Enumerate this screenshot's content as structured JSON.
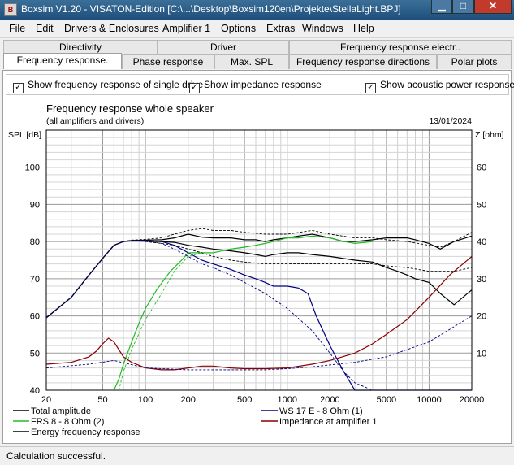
{
  "window": {
    "title": "Boxsim V1.20 - VISATON-Edition [C:\\...\\Desktop\\Boxsim120en\\Projekte\\StellaLight.BPJ]",
    "icon_text": "B"
  },
  "menu": [
    "File",
    "Edit",
    "Drivers & Enclosures",
    "Amplifier 1",
    "Options",
    "Extras",
    "Windows",
    "Help"
  ],
  "tabs_row1": [
    "Directivity",
    "Driver",
    "Frequency response electr.."
  ],
  "tabs_row2": [
    "Frequency response.",
    "Phase response",
    "Max. SPL",
    "Frequency response directions",
    "Polar plots"
  ],
  "options": {
    "single_drive": {
      "label": "Show frequency response of single drive",
      "checked": true
    },
    "impedance": {
      "label": "Show impedance response",
      "checked": true
    },
    "acoustic_power": {
      "label": "Show acoustic power response",
      "checked": true
    }
  },
  "status": "Calculation successful.",
  "colors": {
    "total": "#000000",
    "woofer": "#000080",
    "tweeter": "#22bb22",
    "impedance": "#880000",
    "energy": "#000000"
  },
  "chart_data": {
    "type": "line",
    "title": "Frequency response whole speaker",
    "subtitle": "(all amplifiers and drivers)",
    "date": "13/01/2024",
    "ylabel": "SPL [dB]",
    "y2label": "Z [ohm]",
    "xscale": "log",
    "xlim": [
      20,
      20000
    ],
    "ylim": [
      40,
      110
    ],
    "y2lim": [
      0,
      70
    ],
    "grid": true,
    "xticks": [
      "20",
      "50",
      "100",
      "200",
      "500",
      "1000",
      "2000",
      "5000",
      "10000",
      "20000"
    ],
    "yticks": [
      "40",
      "50",
      "60",
      "70",
      "80",
      "90",
      "100"
    ],
    "y2ticks": [
      "10",
      "20",
      "30",
      "40",
      "50",
      "60"
    ],
    "series": [
      {
        "name": "Total amplitude",
        "key": "total",
        "axis": "spl",
        "dashed": false,
        "x": [
          20,
          30,
          40,
          50,
          60,
          70,
          80,
          100,
          130,
          160,
          200,
          250,
          300,
          400,
          500,
          600,
          700,
          800,
          1000,
          1200,
          1500,
          2000,
          2500,
          3000,
          4000,
          5000,
          6000,
          7000,
          8000,
          10000,
          12000,
          15000,
          20000
        ],
        "y": [
          59.5,
          65,
          71,
          75.5,
          79,
          80,
          80.3,
          80.4,
          80.5,
          81,
          82,
          81.2,
          81,
          81,
          80.5,
          80.5,
          80,
          80.5,
          81,
          81.5,
          82,
          81,
          80,
          80,
          80.5,
          81,
          81,
          81,
          80.5,
          79.5,
          78,
          80,
          81.5
        ]
      },
      {
        "name": "WS 17 E - 8 Ohm  (1)",
        "key": "woofer",
        "axis": "spl",
        "dashed": false,
        "x": [
          20,
          30,
          40,
          50,
          60,
          70,
          80,
          100,
          130,
          160,
          200,
          250,
          300,
          400,
          500,
          600,
          700,
          800,
          1000,
          1200,
          1400,
          1600,
          2000,
          2500,
          3000,
          4000,
          20000
        ],
        "y": [
          59.5,
          65,
          71,
          75.5,
          79,
          80,
          80.3,
          80.3,
          80,
          79,
          77,
          75,
          74,
          72.5,
          71,
          70,
          69,
          68,
          68,
          67.5,
          66,
          60,
          52,
          45,
          40,
          40,
          40
        ]
      },
      {
        "name": "FRS 8 - 8 Ohm (2)",
        "key": "tweeter",
        "axis": "spl",
        "dashed": false,
        "x": [
          60,
          65,
          70,
          80,
          90,
          100,
          120,
          150,
          180,
          200,
          250,
          300,
          400,
          500,
          600,
          700,
          800,
          1000,
          1200,
          1500,
          2000,
          2500,
          3000,
          4000
        ],
        "y": [
          40,
          43,
          47,
          53,
          58,
          62,
          67,
          72,
          75,
          77,
          77,
          77,
          78,
          78.5,
          79,
          79.5,
          80,
          81,
          81,
          81.5,
          81,
          80,
          79.5,
          80
        ]
      },
      {
        "name": "Energy frequency response",
        "key": "energy",
        "axis": "spl",
        "dashed": false,
        "x": [
          20,
          30,
          40,
          50,
          60,
          70,
          80,
          100,
          130,
          160,
          200,
          250,
          300,
          400,
          500,
          600,
          700,
          800,
          1000,
          1200,
          1500,
          2000,
          3000,
          4000,
          5000,
          6000,
          7000,
          8000,
          10000,
          12000,
          15000,
          20000
        ],
        "y": [
          59.5,
          65,
          71,
          75.5,
          79,
          80,
          80.2,
          80.1,
          80,
          79.8,
          79,
          78.5,
          78,
          77.5,
          77,
          76.5,
          76,
          76.5,
          77,
          77,
          76.5,
          76,
          75,
          74.5,
          73,
          72,
          71,
          70,
          69,
          66,
          63,
          67
        ]
      },
      {
        "name": "Impedance at amplifier 1",
        "key": "impedance",
        "axis": "z",
        "dashed": false,
        "x": [
          20,
          30,
          40,
          45,
          50,
          55,
          60,
          70,
          80,
          100,
          130,
          160,
          200,
          250,
          300,
          400,
          500,
          700,
          1000,
          1500,
          2000,
          3000,
          4000,
          5000,
          7000,
          10000,
          14000,
          20000
        ],
        "y": [
          7,
          7.5,
          9,
          10.5,
          12.5,
          14,
          13,
          9,
          7.5,
          6,
          5.5,
          5.5,
          6,
          6.5,
          6.5,
          6,
          5.8,
          5.8,
          6,
          7,
          8,
          10,
          12.5,
          15,
          19,
          25,
          31,
          36
        ]
      },
      {
        "name": "",
        "key": "total",
        "axis": "spl",
        "dashed": true,
        "x": [
          20,
          30,
          40,
          50,
          60,
          70,
          80,
          100,
          130,
          160,
          200,
          250,
          300,
          400,
          500,
          700,
          1000,
          1500,
          2000,
          3000,
          4000,
          5000,
          7000,
          10000,
          12000,
          15000,
          20000
        ],
        "y": [
          59.5,
          65,
          71,
          75.5,
          79,
          80,
          80.4,
          80.6,
          81,
          82,
          83,
          83.5,
          83,
          83,
          82.5,
          82,
          82,
          83,
          82,
          81,
          81,
          80.5,
          80,
          79,
          78.5,
          80,
          82.5
        ]
      },
      {
        "name": "",
        "key": "woofer",
        "axis": "spl",
        "dashed": true,
        "x": [
          20,
          30,
          40,
          50,
          60,
          70,
          80,
          100,
          130,
          160,
          200,
          250,
          300,
          400,
          500,
          700,
          1000,
          1500,
          2000,
          2500,
          3000,
          4000
        ],
        "y": [
          59.5,
          65,
          71,
          75.5,
          79,
          80,
          80.3,
          80.3,
          79.5,
          78,
          76,
          74,
          73,
          71,
          69,
          66,
          62,
          56,
          50,
          45,
          42,
          40
        ]
      },
      {
        "name": "",
        "key": "tweeter",
        "axis": "spl",
        "dashed": true,
        "x": [
          65,
          70,
          80,
          100,
          130,
          160,
          200,
          250,
          300,
          400,
          500
        ],
        "y": [
          40,
          45,
          51,
          59,
          66,
          72,
          76,
          77,
          77,
          78,
          78.5
        ]
      },
      {
        "name": "",
        "key": "energy",
        "axis": "spl",
        "dashed": true,
        "x": [
          100,
          130,
          160,
          200,
          250,
          300,
          400,
          500,
          700,
          1000,
          1500,
          2000,
          3000,
          4000,
          5000,
          7000,
          10000,
          15000,
          20000
        ],
        "y": [
          80,
          79.5,
          79,
          78,
          77,
          76,
          75,
          74.5,
          74,
          74,
          74,
          74,
          74,
          74,
          73.5,
          73,
          72,
          72,
          73
        ]
      },
      {
        "name": "",
        "key": "woofer",
        "axis": "z",
        "dashed": true,
        "x": [
          20,
          40,
          60,
          100,
          200,
          400,
          700,
          1000,
          1500,
          2000,
          3000,
          5000,
          10000,
          20000
        ],
        "y": [
          6,
          7,
          8,
          6,
          5.5,
          5.5,
          5.5,
          5.8,
          6.3,
          6.8,
          7.5,
          9,
          13,
          20
        ]
      }
    ],
    "legend": [
      {
        "key": "total",
        "label": "Total amplitude"
      },
      {
        "key": "woofer",
        "label": "WS 17 E - 8 Ohm  (1)"
      },
      {
        "key": "tweeter",
        "label": "FRS 8 - 8 Ohm (2)"
      },
      {
        "key": "impedance",
        "label": "Impedance at amplifier 1"
      },
      {
        "key": "energy",
        "label": "Energy frequency response"
      }
    ]
  }
}
